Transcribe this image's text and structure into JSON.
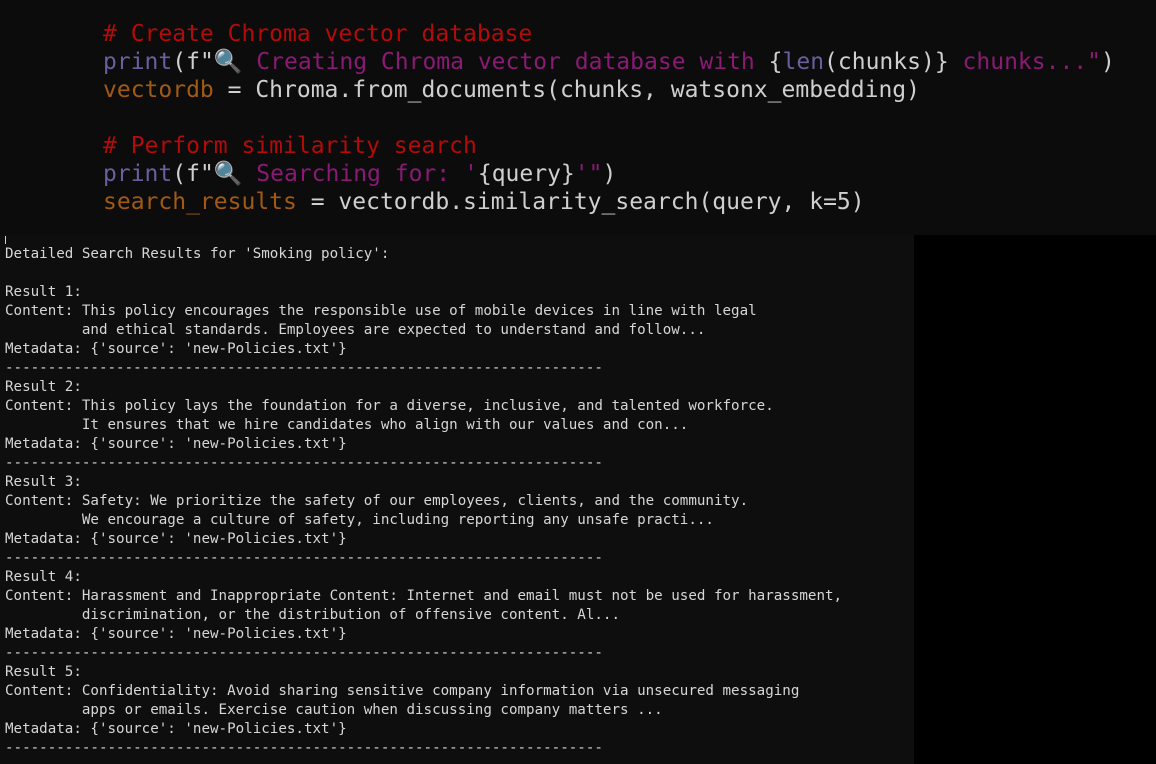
{
  "editor": {
    "comment1": "# Create Chroma vector database",
    "print1": {
      "fn": "print",
      "open": "(f\"",
      "emoji": "🔍",
      "msg": " Creating Chroma vector database with ",
      "expr_open": "{",
      "len": "len",
      "chunks_expr": "(chunks)",
      "expr_close": "}",
      "tail": " chunks...\"",
      "close": ")"
    },
    "assign1": {
      "var": "vectordb",
      "rest": " = Chroma.from_documents(chunks, watsonx_embedding)"
    },
    "comment2": "# Perform similarity search",
    "print2": {
      "fn": "print",
      "open": "(f\"",
      "emoji": "🔍",
      "msg": " Searching for: '",
      "expr": "{query}",
      "tail": "'\"",
      "close": ")"
    },
    "assign2": {
      "var": "search_results",
      "rest": " = vectordb.similarity_search(query, k=5)"
    }
  },
  "terminal": {
    "header": "Detailed Search Results for 'Smoking policy':",
    "separator": "----------------------------------------------------------------------",
    "results": [
      {
        "title": "Result 1:",
        "line1": "Content: This policy encourages the responsible use of mobile devices in line with legal",
        "line2": "         and ethical standards. Employees are expected to understand and follow...",
        "metadata": "Metadata: {'source': 'new-Policies.txt'}"
      },
      {
        "title": "Result 2:",
        "line1": "Content: This policy lays the foundation for a diverse, inclusive, and talented workforce.",
        "line2": "         It ensures that we hire candidates who align with our values and con...",
        "metadata": "Metadata: {'source': 'new-Policies.txt'}"
      },
      {
        "title": "Result 3:",
        "line1": "Content: Safety: We prioritize the safety of our employees, clients, and the community.",
        "line2": "         We encourage a culture of safety, including reporting any unsafe practi...",
        "metadata": "Metadata: {'source': 'new-Policies.txt'}"
      },
      {
        "title": "Result 4:",
        "line1": "Content: Harassment and Inappropriate Content: Internet and email must not be used for harassment,",
        "line2": "         discrimination, or the distribution of offensive content. Al...",
        "metadata": "Metadata: {'source': 'new-Policies.txt'}"
      },
      {
        "title": "Result 5:",
        "line1": "Content: Confidentiality: Avoid sharing sensitive company information via unsecured messaging",
        "line2": "         apps or emails. Exercise caution when discussing company matters ...",
        "metadata": "Metadata: {'source': 'new-Policies.txt'}"
      }
    ]
  }
}
